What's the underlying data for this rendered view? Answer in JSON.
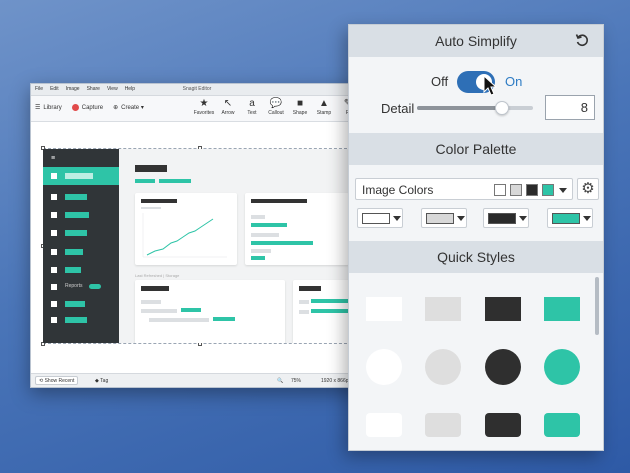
{
  "editor": {
    "menus": [
      "File",
      "Edit",
      "Image",
      "Share",
      "View",
      "Help"
    ],
    "title": "Snagit Editor",
    "library_label": "Library",
    "capture_label": "Capture",
    "create_label": "Create",
    "tools": [
      {
        "label": "Favorites",
        "icon": "star-icon",
        "glyph": "★"
      },
      {
        "label": "Arrow",
        "icon": "arrow-icon",
        "glyph": "↖"
      },
      {
        "label": "Text",
        "icon": "text-icon",
        "glyph": "a"
      },
      {
        "label": "Callout",
        "icon": "callout-icon",
        "glyph": "💬"
      },
      {
        "label": "Shape",
        "icon": "shape-icon",
        "glyph": "■"
      },
      {
        "label": "Stamp",
        "icon": "stamp-icon",
        "glyph": "▲"
      },
      {
        "label": "Fi",
        "icon": "fill-icon",
        "glyph": "✎"
      }
    ],
    "mini_reports_label": "Reports",
    "mini_recent_label": "Last Refreshed | Storage",
    "status": {
      "show_recent": "Show Recent",
      "tag": "Tag",
      "zoom": "75%",
      "dimensions": "1920 x 866p"
    }
  },
  "panel": {
    "auto_simplify": {
      "title": "Auto Simplify",
      "off_label": "Off",
      "on_label": "On",
      "toggle_on": true,
      "detail_label": "Detail",
      "detail_value": "8",
      "detail_fraction": 0.73
    },
    "color_palette": {
      "title": "Color Palette",
      "selected": "Image Colors",
      "swatches": [
        "#ffffff",
        "#d8d8d8",
        "#2b2b2b",
        "#2ec4a7"
      ],
      "color_buttons": [
        "#ffffff",
        "#d8d8d8",
        "#2b2b2b",
        "#2ec4a7"
      ]
    },
    "quick_styles": {
      "title": "Quick Styles",
      "colors": [
        "#ffffff",
        "#dedede",
        "#2f2f2f",
        "#2ec4a7"
      ]
    }
  }
}
